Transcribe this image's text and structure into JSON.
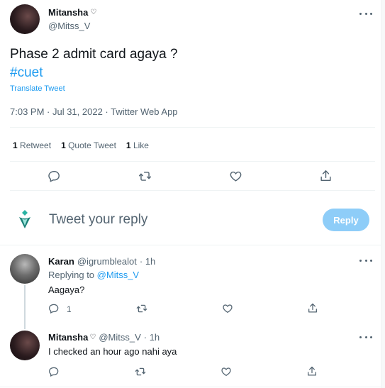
{
  "tweet": {
    "author_name": "Mitansha",
    "author_handle": "@Mitss_V",
    "text": "Phase 2 admit card agaya ?",
    "hashtag": "#cuet",
    "translate": "Translate Tweet",
    "meta": "7:03 PM · Jul 31, 2022 · Twitter Web App",
    "stats": [
      {
        "count": "1",
        "label": "Retweet"
      },
      {
        "count": "1",
        "label": "Quote Tweet"
      },
      {
        "count": "1",
        "label": "Like"
      }
    ]
  },
  "composer": {
    "placeholder": "Tweet your reply",
    "reply_label": "Reply"
  },
  "replies": [
    {
      "name": "Karan",
      "handle": "@igrumblealot",
      "time": "· 1h",
      "replying_prefix": "Replying to",
      "replying_to": "@Mitss_V",
      "text": "Aagaya?",
      "reply_count": "1"
    },
    {
      "name": "Mitansha",
      "handle": "@Mitss_V",
      "time": "· 1h",
      "text": "I checked an hour ago nahi aya"
    }
  ],
  "colors": {
    "accent": "#1d9bf0",
    "muted": "#536471",
    "disabled_button": "#8ecdf8"
  }
}
